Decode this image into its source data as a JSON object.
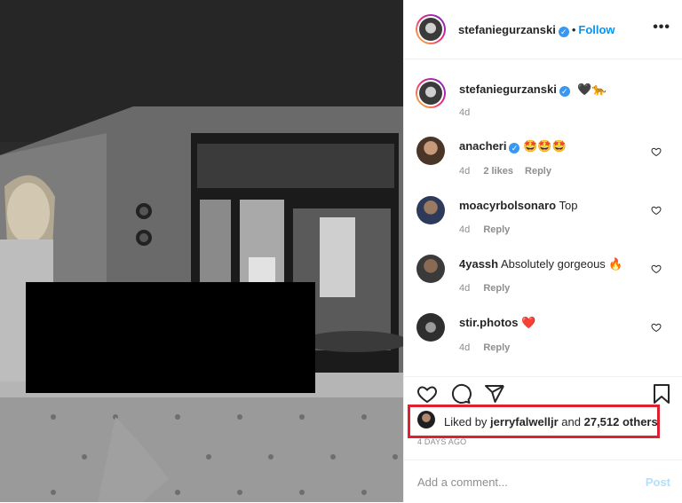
{
  "header": {
    "username": "stefaniegurzanski",
    "follow_label": "Follow",
    "separator": "•",
    "more_label": "•••"
  },
  "caption": {
    "username": "stefaniegurzanski",
    "text": "🖤🐆",
    "time": "4d"
  },
  "comments": [
    {
      "username": "anacheri",
      "text": "🤩🤩🤩",
      "time": "4d",
      "likes": "2 likes",
      "reply": "Reply",
      "verified": true
    },
    {
      "username": "moacyrbolsonaro",
      "text": "Top",
      "time": "4d",
      "reply": "Reply",
      "verified": false
    },
    {
      "username": "4yassh",
      "text": "Absolutely gorgeous 🔥",
      "time": "4d",
      "reply": "Reply",
      "verified": false
    },
    {
      "username": "stir.photos",
      "text": "❤️",
      "time": "4d",
      "reply": "Reply",
      "verified": false
    }
  ],
  "likes": {
    "prefix": "Liked by",
    "user": "jerryfalwelljr",
    "and": "and",
    "others": "27,512 others"
  },
  "timestamp": "4 DAYS AGO",
  "add_comment": {
    "placeholder": "Add a comment...",
    "post_label": "Post"
  },
  "colors": {
    "accent": "#0095f6",
    "highlight_box": "#e0202e",
    "verified": "#3897f0"
  }
}
